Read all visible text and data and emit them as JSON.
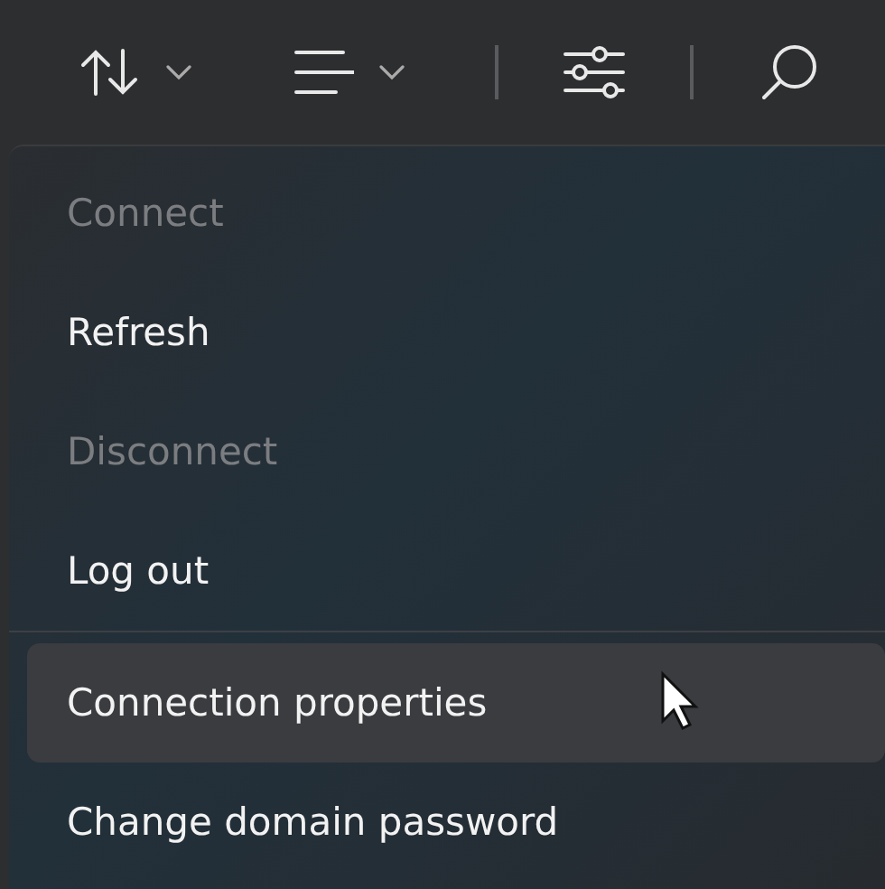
{
  "toolbar": {
    "buttons": [
      {
        "kind": "sort",
        "dropdown": true
      },
      {
        "kind": "view",
        "dropdown": true
      },
      {
        "kind": "divider"
      },
      {
        "kind": "filter",
        "dropdown": false
      },
      {
        "kind": "divider"
      },
      {
        "kind": "search",
        "dropdown": false
      }
    ]
  },
  "menu": {
    "items": [
      {
        "kind": "item",
        "label": "Connect",
        "disabled": true,
        "highlighted": false
      },
      {
        "kind": "item",
        "label": "Refresh",
        "disabled": false,
        "highlighted": false
      },
      {
        "kind": "item",
        "label": "Disconnect",
        "disabled": true,
        "highlighted": false
      },
      {
        "kind": "item",
        "label": "Log out",
        "disabled": false,
        "highlighted": false
      },
      {
        "kind": "separator"
      },
      {
        "kind": "item",
        "label": "Connection properties",
        "disabled": false,
        "highlighted": true
      },
      {
        "kind": "item",
        "label": "Change domain password",
        "disabled": false,
        "highlighted": false
      }
    ]
  }
}
